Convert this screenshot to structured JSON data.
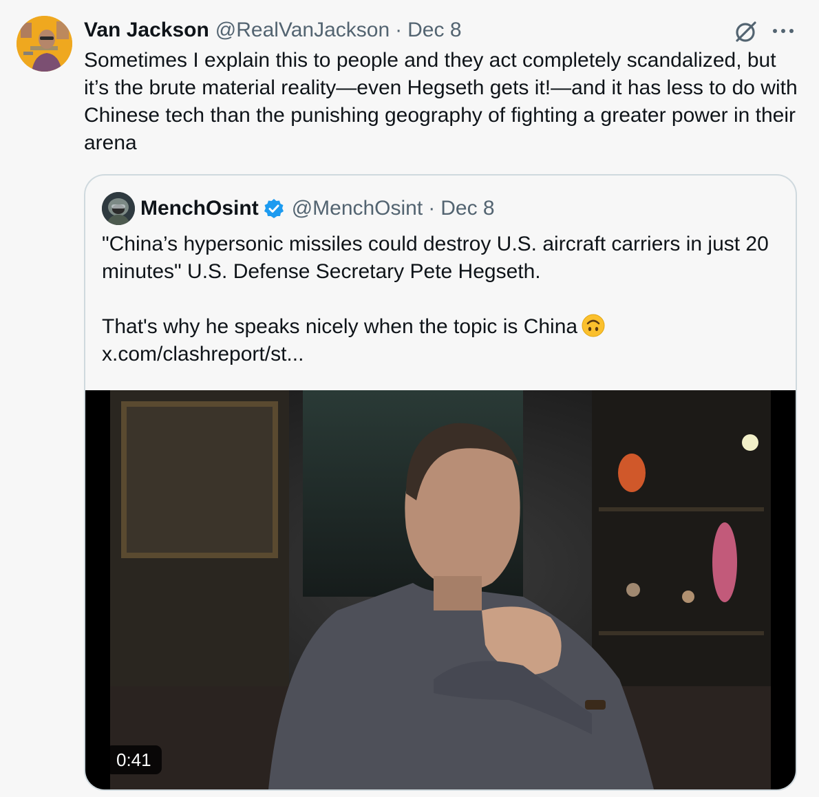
{
  "tweet": {
    "author": {
      "display_name": "Van Jackson",
      "handle": "@RealVanJackson",
      "date": "Dec 8"
    },
    "separator": "·",
    "text": "Sometimes I explain this to people and they act completely scandalized, but it’s the brute material reality—even Hegseth gets it!—and it has less to do with Chinese tech than the punishing geography of fighting a greater power in their arena",
    "icons": [
      "grok-icon",
      "more-icon"
    ]
  },
  "quoted_tweet": {
    "author": {
      "display_name": "MenchOsint",
      "handle": "@MenchOsint",
      "date": "Dec 8",
      "verified": true
    },
    "separator": "·",
    "text_lines": [
      "\"China’s hypersonic missiles could destroy U.S. aircraft carriers in just 20 minutes\" U.S. Defense Secretary Pete Hegseth.",
      "",
      "That's why he speaks nicely when the topic is China",
      "x.com/clashreport/st..."
    ],
    "emoji": "upside-down-face",
    "video": {
      "duration": "0:41"
    }
  },
  "colors": {
    "background": "#f7f7f7",
    "text": "#0f1419",
    "secondary_text": "#536471",
    "border": "#cfd9de",
    "verified_blue": "#1d9bf0"
  }
}
